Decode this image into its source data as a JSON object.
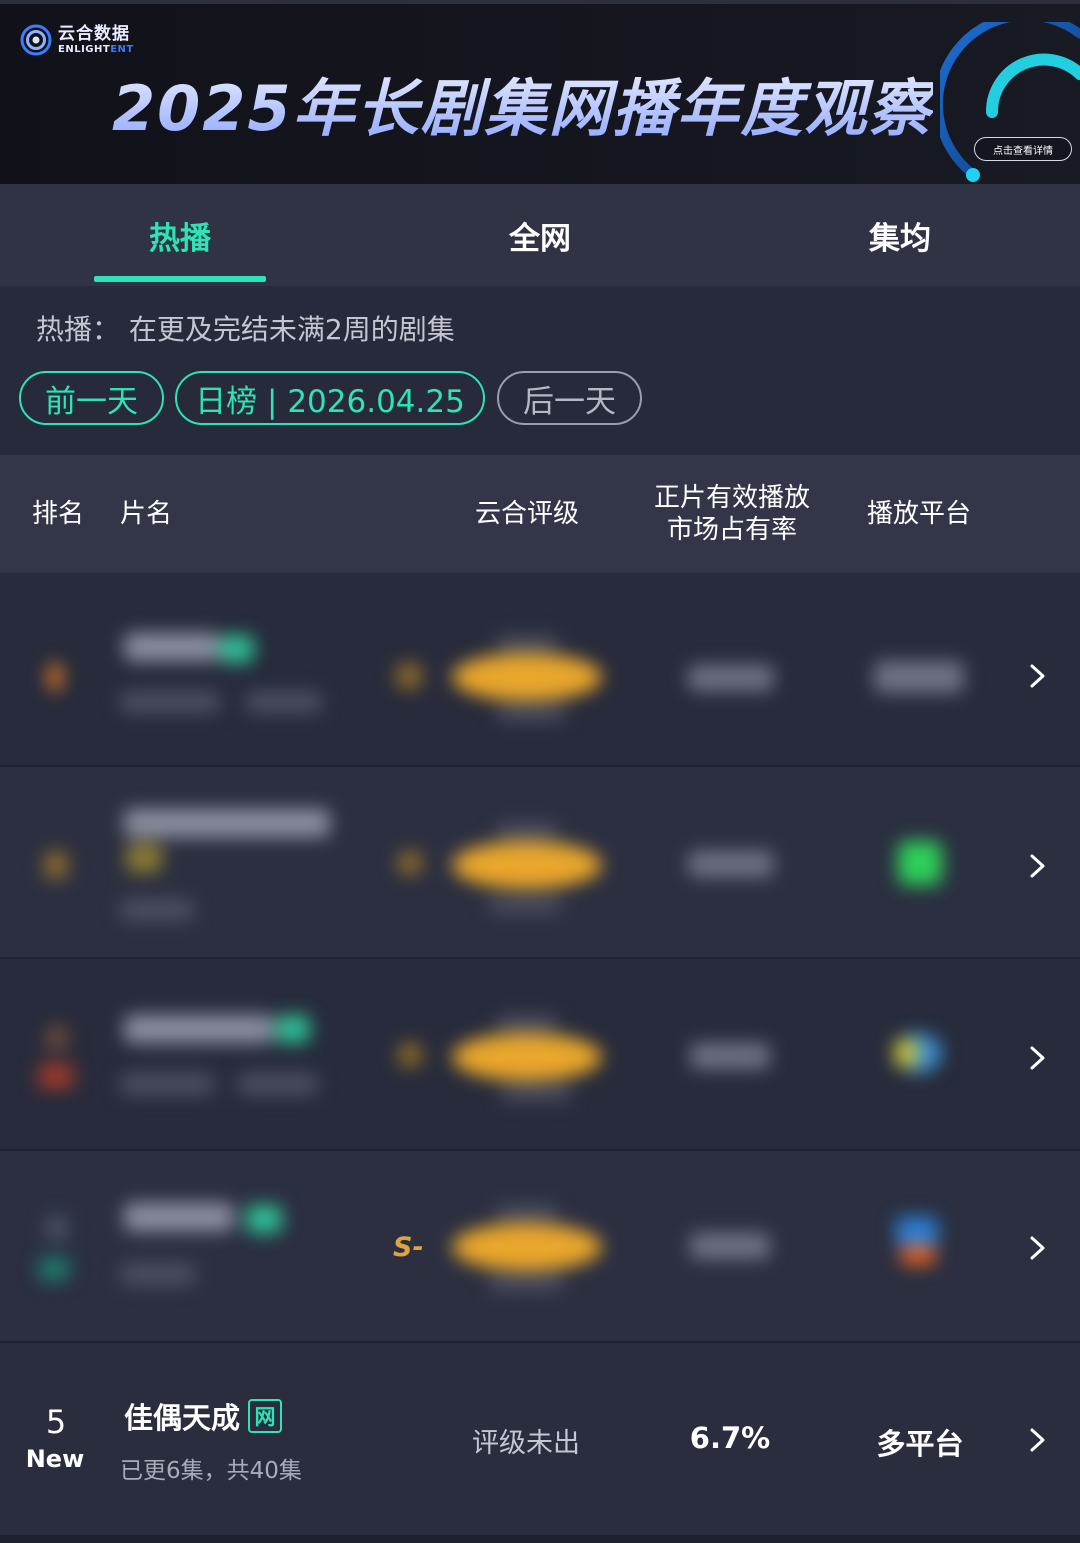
{
  "banner": {
    "logo_cn": "云合数据",
    "logo_en_main": "ENLIGHT",
    "logo_en_accent": "ENT",
    "title": "2025年长剧集网播年度观察",
    "detail_button": "点击查看详情"
  },
  "tabs": [
    {
      "label": "热播",
      "active": true
    },
    {
      "label": "全网",
      "active": false
    },
    {
      "label": "集均",
      "active": false
    }
  ],
  "description": "热播：  在更及完结未满2周的剧集",
  "date_nav": {
    "prev": "前一天",
    "current": "日榜 | 2026.04.25",
    "next": "后一天"
  },
  "table": {
    "headers": {
      "rank": "排名",
      "title": "片名",
      "rating": "云合评级",
      "share_line1": "正片有效播放",
      "share_line2": "市场占有率",
      "platform": "播放平台"
    },
    "blurred_rows_note_grade_peek": "S-",
    "rows": [
      {
        "rank": "5",
        "status": "New",
        "title": "佳偶天成",
        "badge": "网",
        "episodes": "已更6集，共40集",
        "rating": "评级未出",
        "share": "6.7%",
        "platform": "多平台"
      }
    ]
  },
  "colors": {
    "accent": "#2ee3b8",
    "banner_title": "#b9c8ff",
    "background": "#262a3a",
    "header_row": "#323648"
  },
  "icons": [
    "logo-mark-icon",
    "chevron-right-icon",
    "ring-graphic-icon"
  ]
}
